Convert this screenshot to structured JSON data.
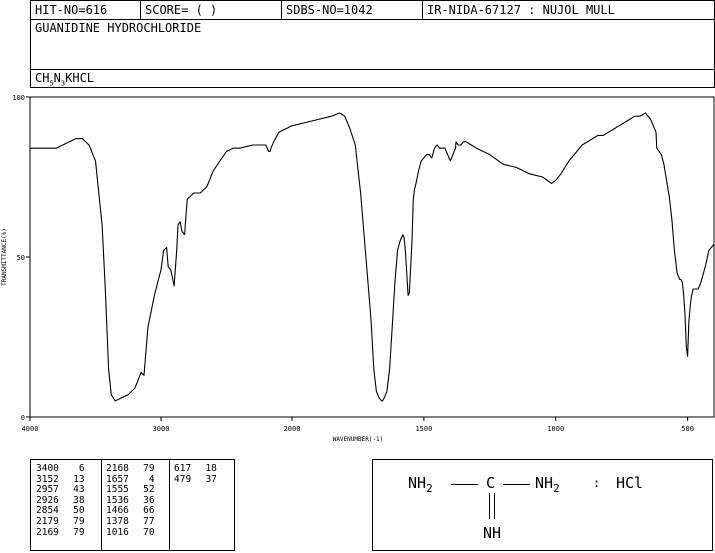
{
  "header": {
    "hit_no": "HIT-NO=616",
    "score": "SCORE=  (   )",
    "sdbs_no": "SDBS-NO=1042",
    "ir_id": "IR-NIDA-67127 : NUJOL MULL"
  },
  "compound": {
    "name": "GUANIDINE HYDROCHLORIDE",
    "formula_parts": [
      "CH",
      "5",
      "N",
      "3",
      "K",
      "HCL"
    ]
  },
  "chart_data": {
    "type": "line",
    "title": "",
    "xlabel": "WAVENUMBER(-1)",
    "ylabel": "TRANSMITTANCE(%)",
    "xlim": [
      4000,
      400
    ],
    "ylim": [
      0,
      100
    ],
    "x_ticks": [
      4000,
      3000,
      2000,
      1500,
      1000,
      500
    ],
    "y_ticks": [
      0,
      50,
      100
    ],
    "grid": false,
    "series": [
      {
        "name": "",
        "x": [
          4000,
          3900,
          3800,
          3700,
          3650,
          3600,
          3550,
          3500,
          3450,
          3425,
          3400,
          3380,
          3350,
          3300,
          3250,
          3200,
          3170,
          3152,
          3130,
          3100,
          3050,
          3000,
          2980,
          2957,
          2945,
          2926,
          2910,
          2900,
          2880,
          2870,
          2854,
          2840,
          2820,
          2800,
          2750,
          2700,
          2650,
          2600,
          2550,
          2500,
          2450,
          2400,
          2300,
          2200,
          2179,
          2169,
          2160,
          2140,
          2100,
          2050,
          2000,
          1950,
          1900,
          1850,
          1820,
          1800,
          1780,
          1760,
          1740,
          1720,
          1700,
          1690,
          1680,
          1670,
          1660,
          1657,
          1650,
          1640,
          1630,
          1620,
          1610,
          1600,
          1590,
          1580,
          1575,
          1570,
          1560,
          1555,
          1545,
          1540,
          1536,
          1530,
          1520,
          1510,
          1500,
          1490,
          1480,
          1470,
          1466,
          1460,
          1450,
          1440,
          1430,
          1420,
          1410,
          1400,
          1390,
          1380,
          1378,
          1370,
          1360,
          1350,
          1340,
          1320,
          1300,
          1250,
          1200,
          1150,
          1100,
          1050,
          1016,
          1000,
          980,
          950,
          920,
          900,
          880,
          860,
          840,
          820,
          800,
          780,
          760,
          740,
          720,
          700,
          680,
          660,
          640,
          620,
          617,
          600,
          590,
          580,
          570,
          560,
          550,
          540,
          530,
          525,
          520,
          515,
          510,
          505,
          500,
          495,
          490,
          485,
          479,
          470,
          460,
          450,
          440,
          430,
          420,
          410,
          400
        ],
        "y": [
          84,
          84,
          84,
          86,
          87,
          87,
          85,
          80,
          60,
          40,
          15,
          7,
          5,
          6,
          7,
          9,
          12,
          14,
          13,
          28,
          38,
          46,
          52,
          53,
          47,
          46,
          43,
          41,
          52,
          60,
          61,
          58,
          57,
          68,
          70,
          70,
          72,
          77,
          80,
          83,
          84,
          84,
          85,
          85,
          83,
          83,
          84,
          86,
          89,
          90,
          91,
          92,
          93,
          94,
          95,
          94,
          90,
          85,
          70,
          50,
          30,
          15,
          8,
          6,
          5,
          5,
          6,
          8,
          15,
          28,
          42,
          52,
          55,
          57,
          56,
          52,
          38,
          39,
          55,
          68,
          71,
          73,
          77,
          80,
          81,
          82,
          82,
          81,
          82,
          84,
          85,
          84,
          84,
          84,
          82,
          80,
          82,
          84,
          86,
          85,
          85,
          86,
          86,
          85,
          84,
          82,
          79,
          78,
          76,
          75,
          73,
          74,
          76,
          80,
          83,
          85,
          86,
          87,
          88,
          88,
          89,
          90,
          91,
          92,
          93,
          94,
          94,
          95,
          93,
          89,
          84,
          82,
          79,
          74,
          69,
          62,
          52,
          45,
          43,
          43,
          42,
          38,
          32,
          22,
          19,
          30,
          35,
          38,
          40,
          40,
          40,
          42,
          45,
          48,
          52,
          53,
          54
        ]
      }
    ]
  },
  "peaks": [
    [
      {
        "wavenumber": "3400",
        "intensity": "6"
      },
      {
        "wavenumber": "3152",
        "intensity": "13"
      },
      {
        "wavenumber": "2957",
        "intensity": "43"
      },
      {
        "wavenumber": "2926",
        "intensity": "38"
      },
      {
        "wavenumber": "2854",
        "intensity": "50"
      },
      {
        "wavenumber": "2179",
        "intensity": "79"
      },
      {
        "wavenumber": "2169",
        "intensity": "79"
      }
    ],
    [
      {
        "wavenumber": "2168",
        "intensity": "79"
      },
      {
        "wavenumber": "1657",
        "intensity": "4"
      },
      {
        "wavenumber": "1555",
        "intensity": "52"
      },
      {
        "wavenumber": "1536",
        "intensity": "36"
      },
      {
        "wavenumber": "1466",
        "intensity": "66"
      },
      {
        "wavenumber": "1378",
        "intensity": "77"
      },
      {
        "wavenumber": "1016",
        "intensity": "70"
      }
    ],
    [
      {
        "wavenumber": "617",
        "intensity": "18"
      },
      {
        "wavenumber": "479",
        "intensity": "37"
      }
    ]
  ],
  "structure": {
    "nh2_left": "NH",
    "nh2_left_sub": "2",
    "carbon": "C",
    "nh2_right": "NH",
    "nh2_right_sub": "2",
    "colon": ":",
    "hcl": "HCl",
    "imine": "NH"
  }
}
